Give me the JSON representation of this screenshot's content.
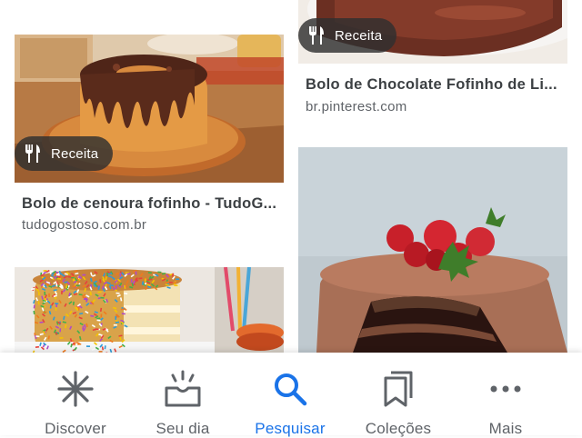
{
  "results": [
    {
      "badge": "Receita",
      "title": "Bolo de Chocolate Fofinho de Li...",
      "source": "br.pinterest.com"
    },
    {
      "badge": "Receita",
      "title": "Bolo de cenoura fofinho - TudoG...",
      "source": "tudogostoso.com.br"
    }
  ],
  "nav": {
    "items": [
      {
        "label": "Discover",
        "icon": "asterisk-icon"
      },
      {
        "label": "Seu dia",
        "icon": "sunrise-icon"
      },
      {
        "label": "Pesquisar",
        "icon": "search-icon"
      },
      {
        "label": "Coleções",
        "icon": "collections-icon"
      },
      {
        "label": "Mais",
        "icon": "more-icon"
      }
    ],
    "active_color": "#1a73e8",
    "inactive_color": "#5f6368"
  }
}
